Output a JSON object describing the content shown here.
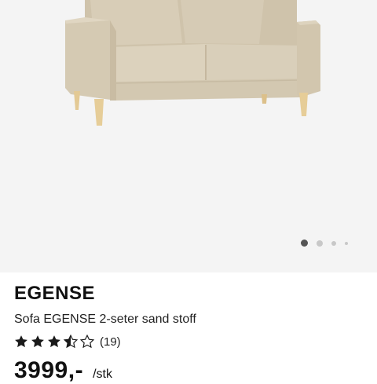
{
  "product": {
    "brand": "EGENSE",
    "subtitle": "Sofa EGENSE 2-seter sand stoff",
    "rating": 3.5,
    "review_count": "(19)",
    "price": "3999,-",
    "unit": "/stk"
  },
  "gallery": {
    "image_icon": "sofa-product-image",
    "slides_total": 4,
    "active_slide": 1
  },
  "colors": {
    "fabric": "#d9ceb8",
    "leg": "#e3c994",
    "star": "#1a1a1a",
    "gallery_bg": "#f4f4f4"
  }
}
